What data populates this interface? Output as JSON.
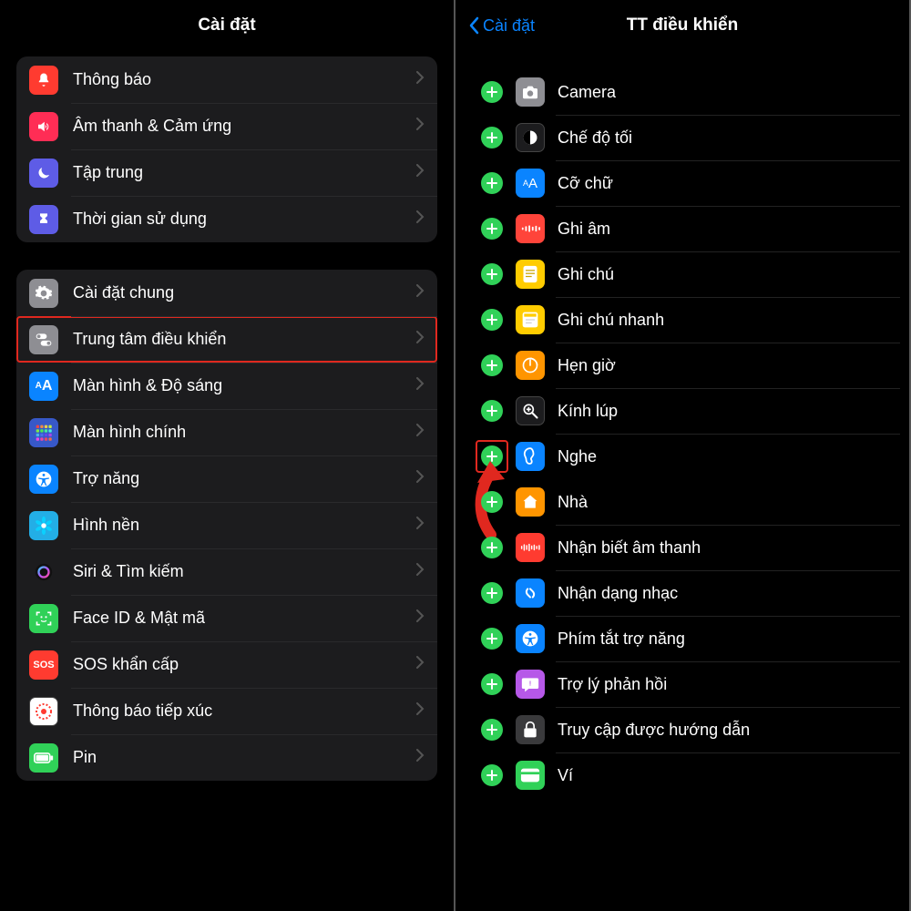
{
  "left": {
    "title": "Cài đặt",
    "group1": [
      {
        "label": "Thông báo",
        "name": "notifications",
        "bg": "#ff3b30",
        "icon": "bell"
      },
      {
        "label": "Âm thanh & Cảm ứng",
        "name": "sounds",
        "bg": "#ff2d55",
        "icon": "speaker"
      },
      {
        "label": "Tập trung",
        "name": "focus",
        "bg": "#5e5ce6",
        "icon": "moon"
      },
      {
        "label": "Thời gian sử dụng",
        "name": "screentime",
        "bg": "#5e5ce6",
        "icon": "hourglass"
      }
    ],
    "group2": [
      {
        "label": "Cài đặt chung",
        "name": "general",
        "bg": "#8e8e93",
        "icon": "gear"
      },
      {
        "label": "Trung tâm điều khiển",
        "name": "control-center",
        "bg": "#8e8e93",
        "icon": "toggles",
        "highlight": true
      },
      {
        "label": "Màn hình & Độ sáng",
        "name": "display",
        "bg": "#0a84ff",
        "icon": "AA"
      },
      {
        "label": "Màn hình chính",
        "name": "homescreen",
        "bg": "#3758c8",
        "icon": "grid"
      },
      {
        "label": "Trợ năng",
        "name": "accessibility",
        "bg": "#0a84ff",
        "icon": "access"
      },
      {
        "label": "Hình nền",
        "name": "wallpaper",
        "bg": "#23aee6",
        "icon": "flower"
      },
      {
        "label": "Siri & Tìm kiếm",
        "name": "siri",
        "bg": "#1c1c1e",
        "icon": "siri"
      },
      {
        "label": "Face ID & Mật mã",
        "name": "faceid",
        "bg": "#30d158",
        "icon": "face"
      },
      {
        "label": "SOS khẩn cấp",
        "name": "sos",
        "bg": "#ff3b30",
        "icon": "SOS"
      },
      {
        "label": "Thông báo tiếp xúc",
        "name": "exposure",
        "bg": "#fff",
        "icon": "exposure"
      },
      {
        "label": "Pin",
        "name": "battery",
        "bg": "#30d158",
        "icon": "battery"
      }
    ]
  },
  "right": {
    "back": "Cài đặt",
    "title": "TT điều khiển",
    "items": [
      {
        "label": "Camera",
        "name": "camera",
        "bg": "#8e8e93",
        "icon": "camera"
      },
      {
        "label": "Chế độ tối",
        "name": "darkmode",
        "bg": "#1c1c1e",
        "icon": "darkmode"
      },
      {
        "label": "Cỡ chữ",
        "name": "textsize",
        "bg": "#0a84ff",
        "icon": "AA"
      },
      {
        "label": "Ghi âm",
        "name": "voicememo",
        "bg": "#ff443a",
        "icon": "wave"
      },
      {
        "label": "Ghi chú",
        "name": "notes",
        "bg": "#ffcc00",
        "icon": "note"
      },
      {
        "label": "Ghi chú nhanh",
        "name": "quicknote",
        "bg": "#ffcc00",
        "icon": "qnote"
      },
      {
        "label": "Hẹn giờ",
        "name": "timer",
        "bg": "#ff9500",
        "icon": "timer"
      },
      {
        "label": "Kính lúp",
        "name": "magnifier",
        "bg": "#1c1c1e",
        "icon": "magnifier"
      },
      {
        "label": "Nghe",
        "name": "hearing",
        "bg": "#0a84ff",
        "icon": "ear",
        "highlightAdd": true
      },
      {
        "label": "Nhà",
        "name": "home",
        "bg": "#ff9500",
        "icon": "house"
      },
      {
        "label": "Nhận biết âm thanh",
        "name": "sound-recog",
        "bg": "#ff3b30",
        "icon": "soundrec"
      },
      {
        "label": "Nhận dạng nhạc",
        "name": "music-recog",
        "bg": "#0a84ff",
        "icon": "shazam"
      },
      {
        "label": "Phím tắt trợ năng",
        "name": "accessibility-sc",
        "bg": "#0a84ff",
        "icon": "access"
      },
      {
        "label": "Trợ lý phản hồi",
        "name": "feedback",
        "bg": "#b658e8",
        "icon": "feedback"
      },
      {
        "label": "Truy cập được hướng dẫn",
        "name": "guided",
        "bg": "#3a3a3c",
        "icon": "lock"
      },
      {
        "label": "Ví",
        "name": "wallet",
        "bg": "#30d158",
        "icon": "wallet"
      }
    ]
  }
}
